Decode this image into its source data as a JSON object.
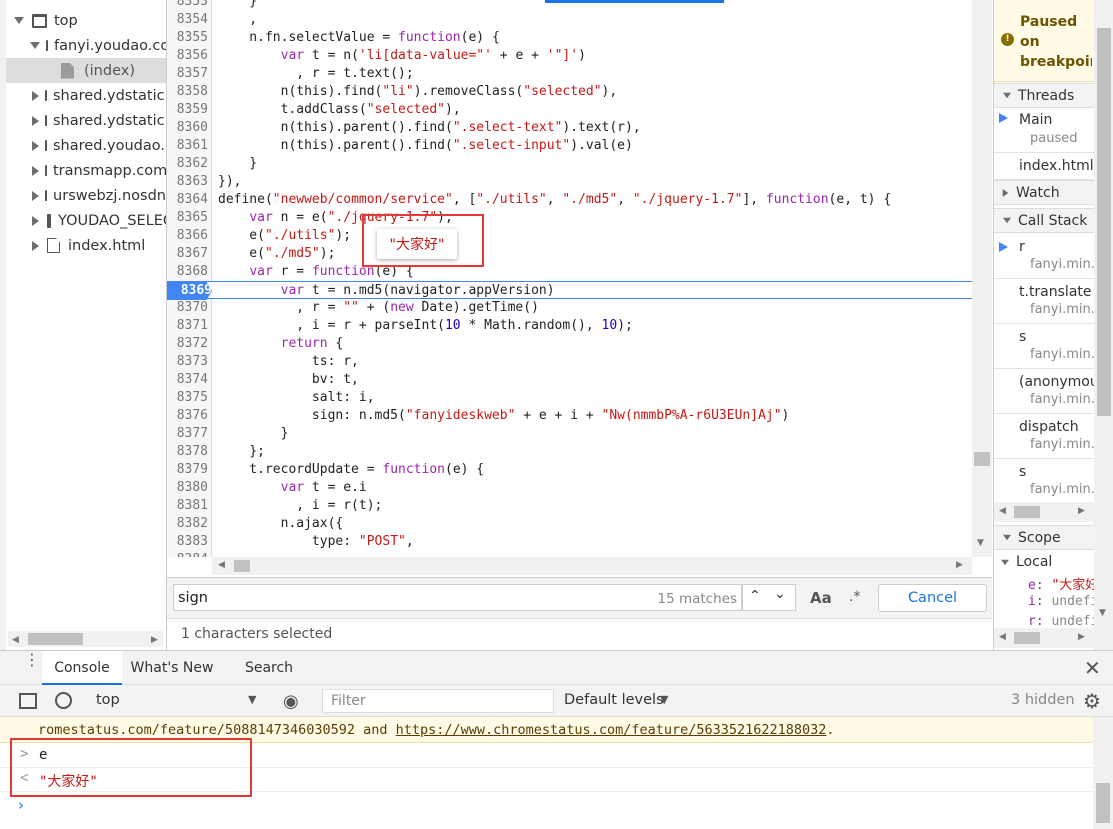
{
  "tree": {
    "items": [
      {
        "label": "top"
      },
      {
        "label": "fanyi.youdao.com"
      },
      {
        "label": "(index)"
      },
      {
        "label": "shared.ydstatic.com"
      },
      {
        "label": "shared.ydstatic.com"
      },
      {
        "label": "shared.youdao.com"
      },
      {
        "label": "transmapp.com"
      },
      {
        "label": "urswebzj.nosdn"
      },
      {
        "label": "YOUDAO_SELECTOR"
      },
      {
        "label": "index.html"
      }
    ]
  },
  "code": {
    "lines": [
      {
        "n": "8353",
        "t": "    }"
      },
      {
        "n": "8354",
        "t": "    ,"
      },
      {
        "n": "8355",
        "t": "    n.fn.selectValue = function(e) {"
      },
      {
        "n": "8356",
        "t": "        var t = n('li[data-value=\"' + e + '\"]')"
      },
      {
        "n": "8357",
        "t": "          , r = t.text();"
      },
      {
        "n": "8358",
        "t": "        n(this).find(\"li\").removeClass(\"selected\"),"
      },
      {
        "n": "8359",
        "t": "        t.addClass(\"selected\"),"
      },
      {
        "n": "8360",
        "t": "        n(this).parent().find(\".select-text\").text(r),"
      },
      {
        "n": "8361",
        "t": "        n(this).parent().find(\".select-input\").val(e)"
      },
      {
        "n": "8362",
        "t": "    }"
      },
      {
        "n": "8363",
        "t": "}),"
      },
      {
        "n": "8364",
        "t": "define(\"newweb/common/service\", [\"./utils\", \"./md5\", \"./jquery-1.7\"], function(e, t) {"
      },
      {
        "n": "8365",
        "t": "    var n = e(\"./jquery-1.7\");"
      },
      {
        "n": "8366",
        "t": "    e(\"./utils\");"
      },
      {
        "n": "8367",
        "t": "    e(\"./md5\");"
      },
      {
        "n": "8368",
        "t": "    var r = function(e) {"
      },
      {
        "n": "8369",
        "t": "        var t = n.md5(navigator.appVersion)"
      },
      {
        "n": "8370",
        "t": "          , r = \"\" + (new Date).getTime()"
      },
      {
        "n": "8371",
        "t": "          , i = r + parseInt(10 * Math.random(), 10);"
      },
      {
        "n": "8372",
        "t": "        return {"
      },
      {
        "n": "8373",
        "t": "            ts: r,"
      },
      {
        "n": "8374",
        "t": "            bv: t,"
      },
      {
        "n": "8375",
        "t": "            salt: i,"
      },
      {
        "n": "8376",
        "t": "            sign: n.md5(\"fanyideskweb\" + e + i + \"Nw(nmmbP%A-r6U3EUn]Aj\")"
      },
      {
        "n": "8377",
        "t": "        }"
      },
      {
        "n": "8378",
        "t": "    };"
      },
      {
        "n": "8379",
        "t": "    t.recordUpdate = function(e) {"
      },
      {
        "n": "8380",
        "t": "        var t = e.i"
      },
      {
        "n": "8381",
        "t": "          , i = r(t);"
      },
      {
        "n": "8382",
        "t": "        n.ajax({"
      },
      {
        "n": "8383",
        "t": "            type: \"POST\","
      },
      {
        "n": "8384",
        "t": ""
      }
    ],
    "tooltip": "\"大家好\""
  },
  "search": {
    "query": "sign",
    "matches": "15 matches",
    "case_label": "Aa",
    "regex_label": ".*",
    "cancel": "Cancel",
    "status": "1 characters selected"
  },
  "right": {
    "paused": "Paused on breakpoint",
    "threads": "Threads",
    "thread_main": "Main",
    "thread_main_sub": "paused",
    "thread_index": "index.html",
    "watch": "Watch",
    "call_stack": "Call Stack",
    "frames": [
      {
        "name": "r",
        "file": "fanyi.min.js"
      },
      {
        "name": "t.translate",
        "file": "fanyi.min.js"
      },
      {
        "name": "s",
        "file": "fanyi.min.js"
      },
      {
        "name": "(anonymous)",
        "file": "fanyi.min.js"
      },
      {
        "name": "dispatch",
        "file": "fanyi.min.js"
      },
      {
        "name": "s",
        "file": "fanyi.min.js"
      }
    ],
    "scope": "Scope",
    "local": "Local",
    "vars": [
      {
        "k": "e:",
        "v": "\"大家好\""
      },
      {
        "k": "i:",
        "v": "undefined"
      },
      {
        "k": "r:",
        "v": "undefined"
      }
    ]
  },
  "drawer": {
    "tabs": [
      "Console",
      "What's New",
      "Search"
    ],
    "context": "top",
    "filter_placeholder": "Filter",
    "levels": "Default levels",
    "hidden": "3 hidden",
    "warning_prefix": "romestatus.com/feature/5088147346030592",
    "warning_and": " and ",
    "warning_link": "https://www.chromestatus.com/feature/5633521622188032",
    "warning_suffix": ".",
    "input_cmd": "e",
    "output_val": "\"大家好\""
  },
  "colors": {
    "breakpoint": "#4285f4",
    "highlight": "#e53935",
    "paused_bg": "#fffbe6"
  }
}
